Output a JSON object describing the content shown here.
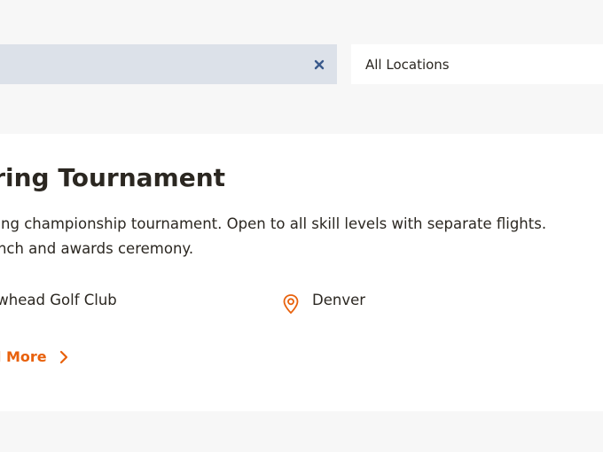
{
  "filters": {
    "search_value": "",
    "location_selected": "All Locations"
  },
  "event": {
    "title": "Spring Tournament",
    "description": "Annual spring championship tournament. Open to all skill levels with separate flights. Includes lunch and awards ceremony.",
    "venue": "Arrowhead Golf Club",
    "city": "Denver",
    "read_more_label": "Read More"
  },
  "colors": {
    "accent": "#e8610c",
    "search_bg": "#dce1e9",
    "clear_icon": "#3a5a8c",
    "page_bg": "#f7f7f7"
  },
  "icons": {
    "clear": "close-icon",
    "location": "map-pin-icon",
    "chevron": "chevron-right-icon"
  }
}
